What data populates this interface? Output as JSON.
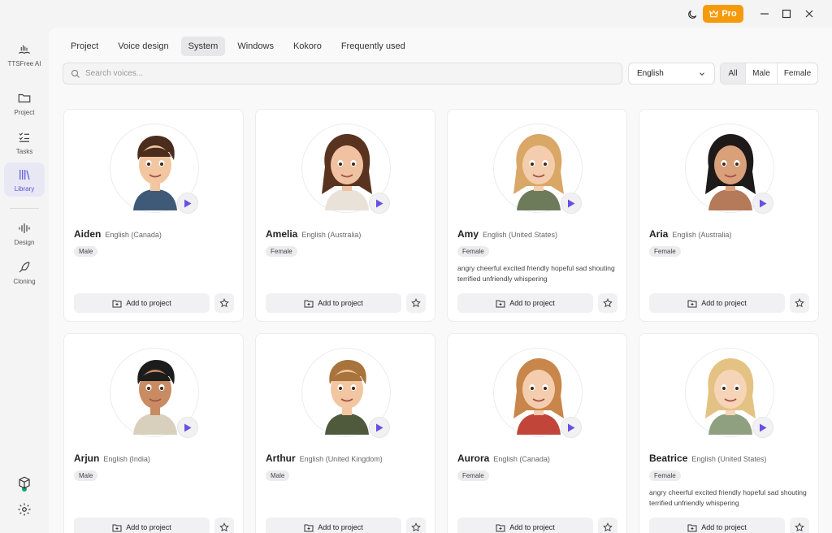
{
  "titlebar": {
    "pro_label": "Pro"
  },
  "sidebar": {
    "app_name": "TTSFree AI",
    "items": [
      {
        "label": "Project",
        "icon": "folder-icon"
      },
      {
        "label": "Tasks",
        "icon": "checklist-icon"
      },
      {
        "label": "Library",
        "icon": "library-icon"
      },
      {
        "label": "Design",
        "icon": "waveform-icon"
      },
      {
        "label": "Cloning",
        "icon": "feather-pen-icon"
      }
    ]
  },
  "tabs": [
    {
      "label": "Project"
    },
    {
      "label": "Voice design"
    },
    {
      "label": "System"
    },
    {
      "label": "Windows"
    },
    {
      "label": "Kokoro"
    },
    {
      "label": "Frequently used"
    }
  ],
  "filters": {
    "search_placeholder": "Search voices...",
    "language": "English",
    "gender": [
      "All",
      "Male",
      "Female"
    ]
  },
  "card_actions": {
    "add_label": "Add to project"
  },
  "voices": [
    {
      "name": "Aiden",
      "lang": "English (Canada)",
      "gender": "Male",
      "tags": ""
    },
    {
      "name": "Amelia",
      "lang": "English (Australia)",
      "gender": "Female",
      "tags": ""
    },
    {
      "name": "Amy",
      "lang": "English (United States)",
      "gender": "Female",
      "tags": "angry cheerful excited friendly hopeful sad shouting terrified unfriendly whispering"
    },
    {
      "name": "Aria",
      "lang": "English (Australia)",
      "gender": "Female",
      "tags": ""
    },
    {
      "name": "Arjun",
      "lang": "English (India)",
      "gender": "Male",
      "tags": ""
    },
    {
      "name": "Arthur",
      "lang": "English (United Kingdom)",
      "gender": "Male",
      "tags": ""
    },
    {
      "name": "Aurora",
      "lang": "English (Canada)",
      "gender": "Female",
      "tags": ""
    },
    {
      "name": "Beatrice",
      "lang": "English (United States)",
      "gender": "Female",
      "tags": "angry cheerful excited friendly hopeful sad shouting terrified unfriendly whispering"
    }
  ],
  "colors": {
    "accent": "#5b4fd6",
    "pro": "#f59a0b",
    "status_online": "#17a36b"
  }
}
